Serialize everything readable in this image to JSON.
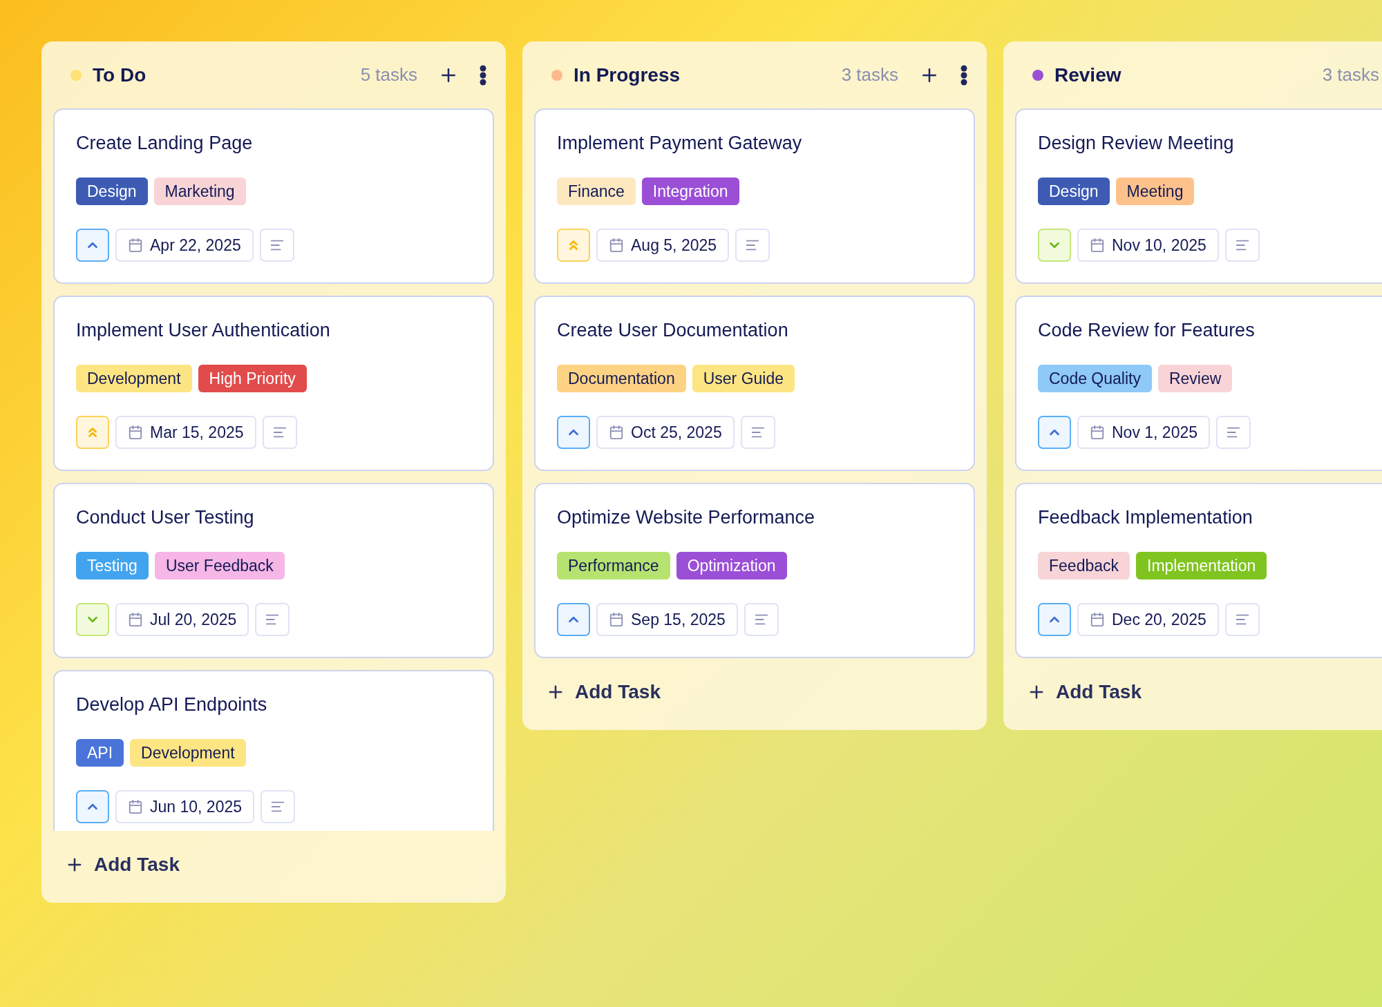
{
  "columns": [
    {
      "title": "To Do",
      "color": "#fde274",
      "count": "5 tasks",
      "add_label": "Add Task",
      "cards": [
        {
          "title": "Create Landing Page",
          "tags": [
            {
              "label": "Design",
              "color": "#3d5bb3"
            },
            {
              "label": "Marketing",
              "color": "#f8d4d6"
            }
          ],
          "priority": {
            "kind": "medium"
          },
          "date": "Apr 22, 2025"
        },
        {
          "title": "Implement User Authentication",
          "tags": [
            {
              "label": "Development",
              "color": "#fde583"
            },
            {
              "label": "High Priority",
              "color": "#e24b4b"
            }
          ],
          "priority": {
            "kind": "high"
          },
          "date": "Mar 15, 2025"
        },
        {
          "title": "Conduct User Testing",
          "tags": [
            {
              "label": "Testing",
              "color": "#42a4ee"
            },
            {
              "label": "User Feedback",
              "color": "#f6b6e6"
            }
          ],
          "priority": {
            "kind": "low"
          },
          "date": "Jul 20, 2025"
        },
        {
          "title": "Develop API Endpoints",
          "tags": [
            {
              "label": "API",
              "color": "#4b74da"
            },
            {
              "label": "Development",
              "color": "#fde583"
            }
          ],
          "priority": {
            "kind": "medium"
          },
          "date": "Jun 10, 2025"
        }
      ]
    },
    {
      "title": "In Progress",
      "color": "#fdb98a",
      "count": "3 tasks",
      "add_label": "Add Task",
      "cards": [
        {
          "title": "Implement Payment Gateway",
          "tags": [
            {
              "label": "Finance",
              "color": "#fde8c0"
            },
            {
              "label": "Integration",
              "color": "#9a4fd6"
            }
          ],
          "priority": {
            "kind": "high"
          },
          "date": "Aug 5, 2025"
        },
        {
          "title": "Create User Documentation",
          "tags": [
            {
              "label": "Documentation",
              "color": "#fdd383"
            },
            {
              "label": "User Guide",
              "color": "#fde583"
            }
          ],
          "priority": {
            "kind": "medium"
          },
          "date": "Oct 25, 2025"
        },
        {
          "title": "Optimize Website Performance",
          "tags": [
            {
              "label": "Performance",
              "color": "#b6e36f"
            },
            {
              "label": "Optimization",
              "color": "#9a4fd6"
            }
          ],
          "priority": {
            "kind": "medium"
          },
          "date": "Sep 15, 2025"
        }
      ]
    },
    {
      "title": "Review",
      "color": "#9a4fd6",
      "count": "3 tasks",
      "add_label": "Add Task",
      "cards": [
        {
          "title": "Design Review Meeting",
          "tags": [
            {
              "label": "Design",
              "color": "#3d5bb3"
            },
            {
              "label": "Meeting",
              "color": "#fdc28c"
            }
          ],
          "priority": {
            "kind": "low"
          },
          "date": "Nov 10, 2025"
        },
        {
          "title": "Code Review for Features",
          "tags": [
            {
              "label": "Code Quality",
              "color": "#8ec9f7"
            },
            {
              "label": "Review",
              "color": "#f8d4d6"
            }
          ],
          "priority": {
            "kind": "medium"
          },
          "date": "Nov 1, 2025"
        },
        {
          "title": "Feedback Implementation",
          "tags": [
            {
              "label": "Feedback",
              "color": "#f8d4d6"
            },
            {
              "label": "Implementation",
              "color": "#7fc41f"
            }
          ],
          "priority": {
            "kind": "medium"
          },
          "date": "Dec 20, 2025"
        }
      ]
    }
  ]
}
